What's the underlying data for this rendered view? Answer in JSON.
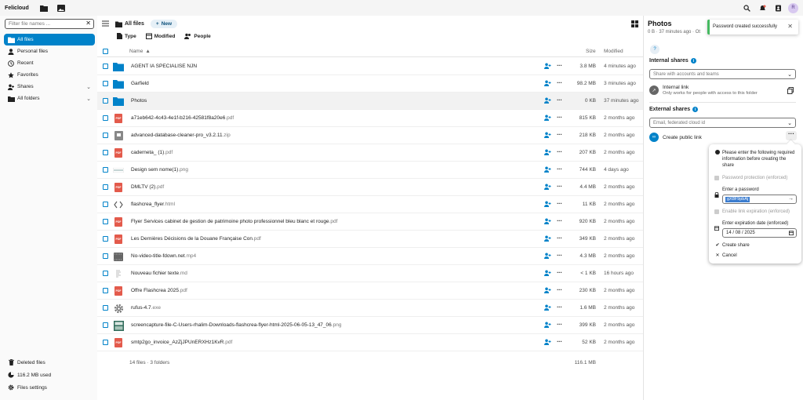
{
  "app": {
    "brand": "Felicloud"
  },
  "sidebar": {
    "filter_placeholder": "Filter file names ...",
    "items": [
      {
        "label": "All files",
        "icon": "folder-icon",
        "active": true
      },
      {
        "label": "Personal files",
        "icon": "user-icon"
      },
      {
        "label": "Recent",
        "icon": "clock-icon"
      },
      {
        "label": "Favorites",
        "icon": "star-icon"
      },
      {
        "label": "Shares",
        "icon": "share-icon",
        "expandable": true
      },
      {
        "label": "All folders",
        "icon": "folders-icon",
        "expandable": true
      }
    ],
    "bottom": [
      {
        "label": "Deleted files",
        "icon": "trash-icon"
      },
      {
        "label": "116.2 MB used",
        "icon": "pie-icon"
      },
      {
        "label": "Files settings",
        "icon": "gear-icon"
      }
    ]
  },
  "main": {
    "breadcrumb": "All files",
    "new_label": "New",
    "filters": [
      "Type",
      "Modified",
      "People"
    ],
    "columns": {
      "name": "Name",
      "size": "Size",
      "modified": "Modified"
    },
    "files": [
      {
        "name": "AGENT IA SPECIALISE NJN",
        "ext": "",
        "type": "folder",
        "size": "3.8 MB",
        "modified": "4 minutes ago"
      },
      {
        "name": "Garfield",
        "ext": "",
        "type": "folder",
        "size": "98.2 MB",
        "modified": "3 minutes ago"
      },
      {
        "name": "Photos",
        "ext": "",
        "type": "folder",
        "size": "0 KB",
        "modified": "37 minutes ago"
      },
      {
        "name": "a71eb642-4c43-4e1f-b216-42581f8a20e6",
        "ext": ".pdf",
        "type": "pdf",
        "size": "815 KB",
        "modified": "2 months ago"
      },
      {
        "name": "advanced-database-cleaner-pro_v3.2.11",
        "ext": ".zip",
        "type": "zip",
        "size": "218 KB",
        "modified": "2 months ago"
      },
      {
        "name": "caderneta_ (1)",
        "ext": ".pdf",
        "type": "pdf",
        "size": "207 KB",
        "modified": "2 months ago"
      },
      {
        "name": "Design sem nome(1)",
        "ext": ".png",
        "type": "image",
        "size": "744 KB",
        "modified": "4 days ago"
      },
      {
        "name": "DMLTV (2)",
        "ext": ".pdf",
        "type": "pdf",
        "size": "4.4 MB",
        "modified": "2 months ago"
      },
      {
        "name": "flashcrea_flyer",
        "ext": ".html",
        "type": "code",
        "size": "11 KB",
        "modified": "2 months ago"
      },
      {
        "name": "Flyer Services cabinet de gestion de patrimoine photo professionnel bleu blanc et rouge",
        "ext": ".pdf",
        "type": "pdf",
        "size": "920 KB",
        "modified": "2 months ago"
      },
      {
        "name": "Les Dernières Décisions de la Douane Française Con",
        "ext": ".pdf",
        "type": "pdf",
        "size": "349 KB",
        "modified": "2 months ago"
      },
      {
        "name": "No-video-title-fdown.net",
        "ext": ".mp4",
        "type": "video",
        "size": "4.3 MB",
        "modified": "2 months ago"
      },
      {
        "name": "Nouveau fichier texte",
        "ext": ".md",
        "type": "text",
        "size": "< 1 KB",
        "modified": "16 hours ago"
      },
      {
        "name": "Offre Flashcrea 2025",
        "ext": ".pdf",
        "type": "pdf",
        "size": "230 KB",
        "modified": "2 months ago"
      },
      {
        "name": "rufus-4.7",
        "ext": ".exe",
        "type": "exe",
        "size": "1.6 MB",
        "modified": "2 months ago"
      },
      {
        "name": "screencapture-file-C-Users-rhalim-Downloads-flashcrea-flyer-html-2025-06-05-13_47_06",
        "ext": ".png",
        "type": "screenshot",
        "size": "399 KB",
        "modified": "2 months ago"
      },
      {
        "name": "smtp2go_invoice_AzZjJPUnERXHz1KvR",
        "ext": ".pdf",
        "type": "pdf",
        "size": "52 KB",
        "modified": "2 months ago"
      }
    ],
    "summary_count": "14 files · 3 folders",
    "summary_size": "116.1 MB"
  },
  "panel": {
    "title": "Photos",
    "subtitle": "0 B  ·  37 minutes ago  ·  Ot",
    "help": "?",
    "internal_title": "Internal shares",
    "internal_placeholder": "Share with accounts and teams",
    "internal_link_title": "Internal link",
    "internal_link_desc": "Only works for people with access to this folder",
    "external_title": "External shares",
    "external_placeholder": "Email, federated cloud id",
    "public_link": "Create public link"
  },
  "popover": {
    "info": "Please enter the following required information before creating the share",
    "pw_protect": "Password protection (enforced)",
    "enter_pw": "Enter a password",
    "pw_value": "gX8F9pbAj",
    "expiry": "Enable link expiration (enforced)",
    "enter_expiry": "Enter expiration date (enforced)",
    "date": "14 / 08 / 2025",
    "create": "Create share",
    "cancel": "Cancel"
  },
  "toast": {
    "message": "Password created successfully"
  },
  "colors": {
    "accent": "#0082c9",
    "pdf": "#e35a4b",
    "success": "#46ba61"
  }
}
